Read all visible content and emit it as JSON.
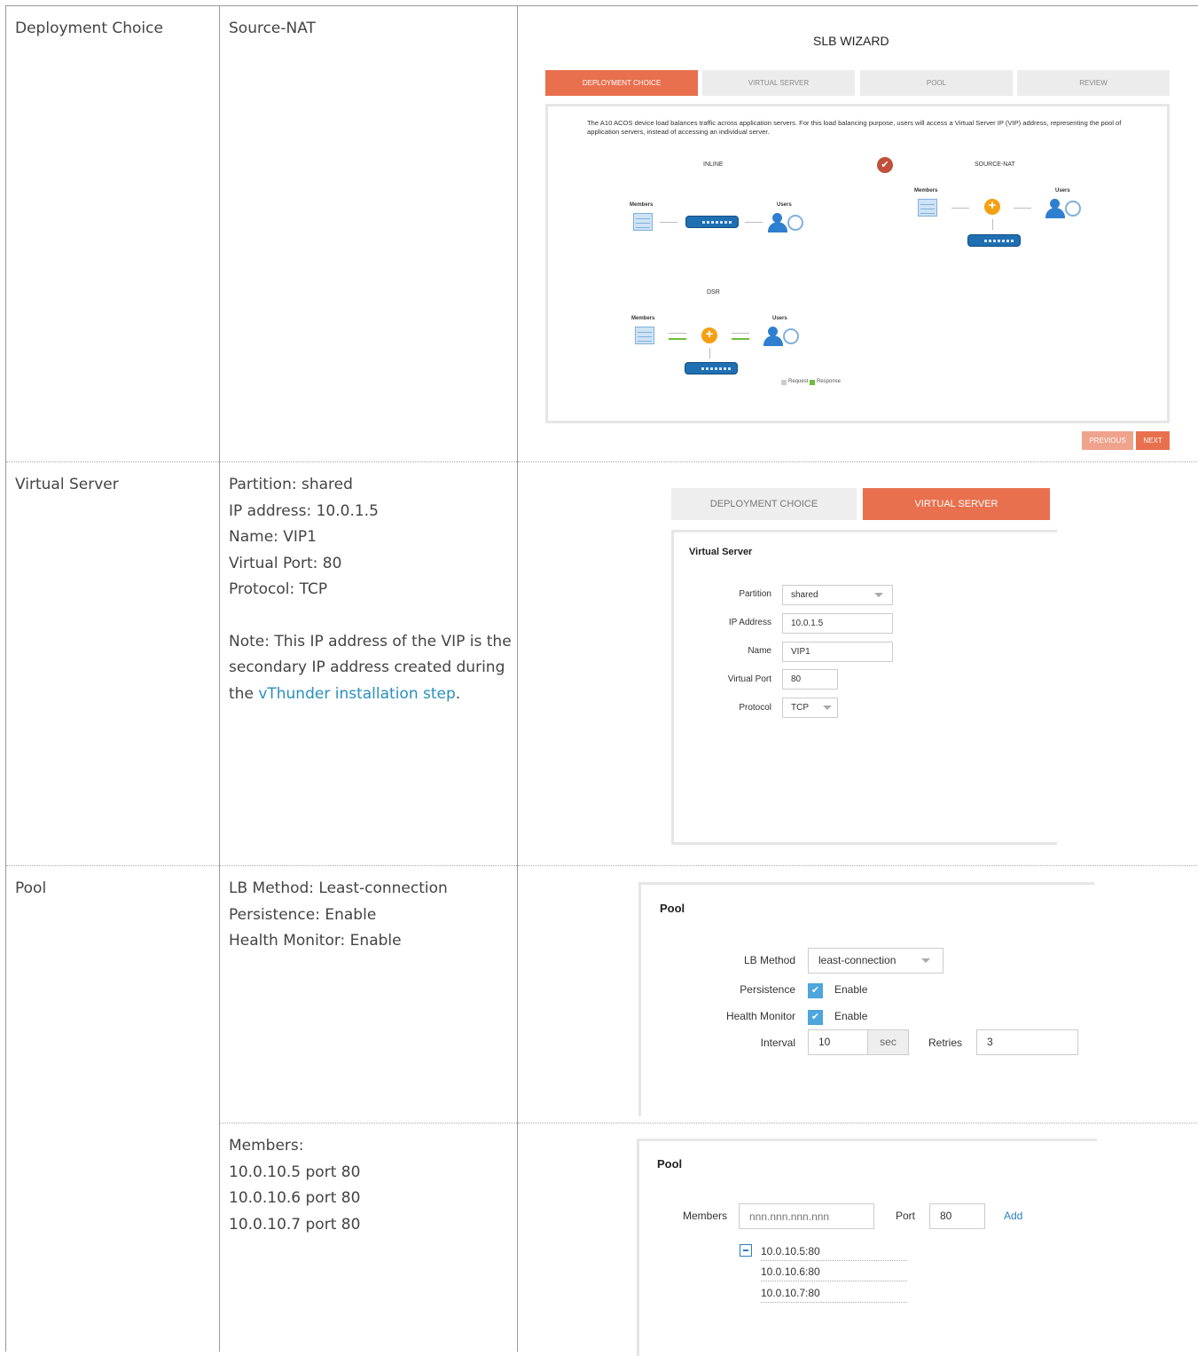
{
  "rows": {
    "deployment": {
      "title": "Deployment Choice",
      "value": "Source-NAT"
    },
    "virtual_server": {
      "title": "Virtual Server",
      "lines": [
        "Partition: shared",
        "IP address: 10.0.1.5",
        "Name: VIP1",
        "Virtual Port: 80",
        "Protocol: TCP"
      ],
      "note_prefix": "Note: This IP address of the VIP is the secondary IP address created during the ",
      "note_link": "vThunder installation step",
      "note_suffix": "."
    },
    "pool": {
      "title": "Pool",
      "lines": [
        "LB Method: Least-connection",
        "Persistence: Enable",
        "Health Monitor: Enable"
      ],
      "members_lines": [
        "Members:",
        "10.0.10.5 port 80",
        "10.0.10.6 port 80",
        "10.0.10.7 port 80"
      ]
    }
  },
  "wizard": {
    "title": "SLB WIZARD",
    "steps": [
      "DEPLOYMENT CHOICE",
      "VIRTUAL SERVER",
      "POOL",
      "REVIEW"
    ],
    "intro": "The A10 ACOS device load balances traffic across application servers. For this load balancing purpose, users will access a Virtual Server IP (VIP) address, representing the pool of application servers, instead of accessing an individual server.",
    "options": {
      "inline": "INLINE",
      "source_nat": "SOURCE-NAT",
      "dsr": "DSR"
    },
    "labels": {
      "members": "Members",
      "users": "Users",
      "device": "A10"
    },
    "legend": {
      "request": "Request",
      "response": "Response"
    },
    "buttons": {
      "previous": "PREVIOUS",
      "next": "NEXT"
    },
    "check": "✔"
  },
  "vs_form": {
    "tabs": [
      "DEPLOYMENT CHOICE",
      "VIRTUAL SERVER"
    ],
    "heading": "Virtual Server",
    "partition_label": "Partition",
    "partition_value": "shared",
    "ip_label": "IP Address",
    "ip_value": "10.0.1.5",
    "name_label": "Name",
    "name_value": "VIP1",
    "port_label": "Virtual Port",
    "port_value": "80",
    "protocol_label": "Protocol",
    "protocol_value": "TCP"
  },
  "pool_form": {
    "heading": "Pool",
    "lb_label": "LB Method",
    "lb_value": "least-connection",
    "persistence_label": "Persistence",
    "persistence_value": "Enable",
    "health_label": "Health Monitor",
    "health_value": "Enable",
    "interval_label": "Interval",
    "interval_value": "10",
    "interval_unit": "sec",
    "retries_label": "Retries",
    "retries_value": "3"
  },
  "members_form": {
    "heading": "Pool",
    "members_label": "Members",
    "members_placeholder": "nnn.nnn.nnn.nnn",
    "port_label": "Port",
    "port_value": "80",
    "add_label": "Add",
    "members": [
      "10.0.10.5:80",
      "10.0.10.6:80",
      "10.0.10.7:80"
    ]
  },
  "colors": {
    "accent": "#e8704e",
    "link": "#2a8fbd",
    "check": "#4da6dc"
  }
}
